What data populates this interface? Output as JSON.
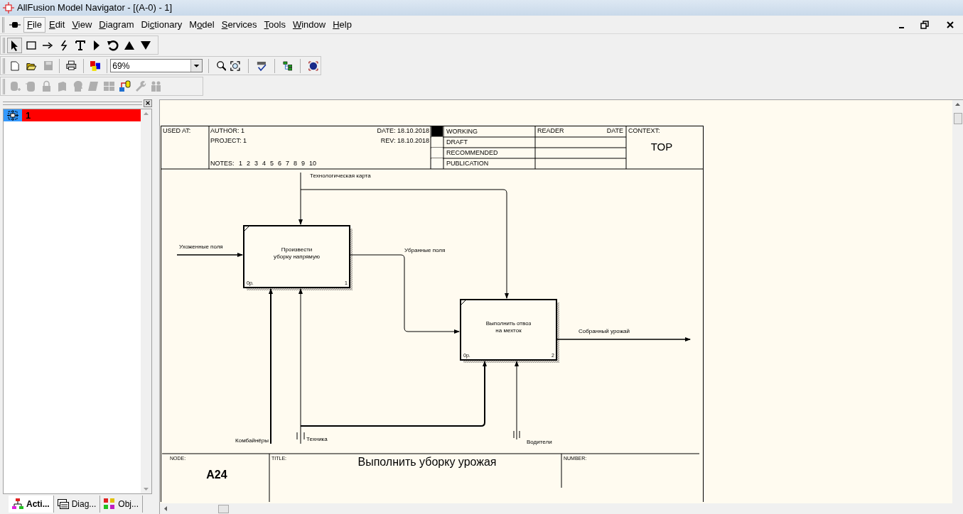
{
  "window": {
    "title": "AllFusion Model Navigator - [(A-0)  - 1]"
  },
  "menu": [
    {
      "key": "F",
      "rest": "ile",
      "selected": true
    },
    {
      "key": "E",
      "rest": "dit",
      "selected": false
    },
    {
      "key": "V",
      "rest": "iew",
      "selected": false
    },
    {
      "key": "D",
      "rest": "iagram",
      "selected": false
    },
    {
      "lead": "Di",
      "key": "c",
      "rest": "tionary",
      "selected": false
    },
    {
      "lead": "M",
      "key": "o",
      "rest": "del",
      "selected": false
    },
    {
      "key": "S",
      "rest": "ervices",
      "selected": false
    },
    {
      "key": "T",
      "rest": "ools",
      "selected": false
    },
    {
      "key": "W",
      "rest": "indow",
      "selected": false
    },
    {
      "key": "H",
      "rest": "elp",
      "selected": false
    }
  ],
  "drawing_tools": [
    {
      "kind": "pointer",
      "selected": true
    },
    {
      "kind": "box",
      "selected": false
    },
    {
      "kind": "arrow",
      "selected": false
    },
    {
      "kind": "squiggle",
      "selected": false
    },
    {
      "kind": "text",
      "selected": false
    },
    {
      "kind": "play",
      "selected": false
    },
    {
      "kind": "rotate",
      "selected": false
    },
    {
      "kind": "up",
      "selected": false
    },
    {
      "kind": "down",
      "selected": false
    }
  ],
  "standard_toolbar": {
    "zoom": "69%"
  },
  "model_toolbar": [
    {
      "kind": "db-add",
      "disabled": true
    },
    {
      "kind": "db",
      "disabled": true
    },
    {
      "kind": "lock",
      "disabled": true
    },
    {
      "kind": "book",
      "disabled": true
    },
    {
      "kind": "head",
      "disabled": true
    },
    {
      "kind": "scroll",
      "disabled": true
    },
    {
      "kind": "grid",
      "disabled": true
    },
    {
      "kind": "transfer",
      "disabled": false
    },
    {
      "kind": "wrench",
      "disabled": true
    },
    {
      "kind": "people",
      "disabled": true
    }
  ],
  "tree": {
    "items": [
      {
        "label": "1",
        "selected": true
      }
    ]
  },
  "panel_tabs": [
    {
      "label": "Acti...",
      "kind": "activities",
      "selected": true
    },
    {
      "label": "Diag...",
      "kind": "diagrams",
      "selected": false
    },
    {
      "label": "Obj...",
      "kind": "objects",
      "selected": false
    }
  ],
  "diagram": {
    "header": {
      "used_at": "USED AT:",
      "author": "AUTHOR:  1",
      "project": "PROJECT:  1",
      "notes_label": "NOTES:",
      "notes": [
        "1",
        "2",
        "3",
        "4",
        "5",
        "6",
        "7",
        "8",
        "9",
        "10"
      ],
      "date": "DATE:  18.10.2018",
      "rev": "REV:    18.10.2018",
      "statuses": [
        {
          "label": "WORKING",
          "selected": true
        },
        {
          "label": "DRAFT",
          "selected": false
        },
        {
          "label": "RECOMMENDED",
          "selected": false
        },
        {
          "label": "PUBLICATION",
          "selected": false
        }
      ],
      "reader": "READER",
      "reader_date": "DATE",
      "context_label": "CONTEXT:",
      "context": "TOP"
    },
    "activities": [
      {
        "lines": [
          "Произвести",
          "уборку напрямую"
        ],
        "cost": "0р.",
        "number": "1"
      },
      {
        "lines": [
          "Выполнить отвоз",
          "на мехток"
        ],
        "cost": "0р.",
        "number": "2"
      }
    ],
    "arrows": {
      "control": "Технологическая карта",
      "input": "Ухоженные поля",
      "middle": "Убранные поля",
      "output": "Собранный урожай",
      "mech1": "Комбайнёры",
      "mech2": "Техника",
      "mech3": "Водители"
    },
    "footer": {
      "node_label": "NODE:",
      "node": "A24",
      "title_label": "TITLE:",
      "title": "Выполнить уборку урожая",
      "number_label": "NUMBER:"
    }
  }
}
